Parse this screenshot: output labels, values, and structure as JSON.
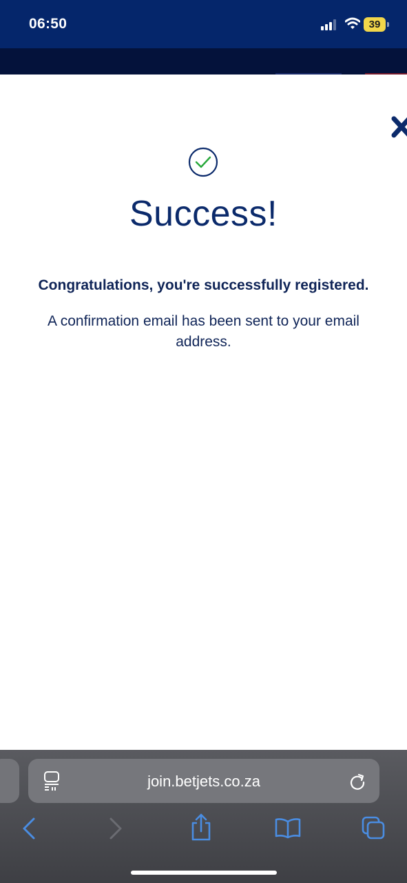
{
  "status_bar": {
    "time": "06:50",
    "battery": "39",
    "icons": [
      "signal-icon",
      "wifi-icon",
      "battery-icon"
    ],
    "background_color": "#05266b"
  },
  "site_header": {
    "background_color": "#04123b"
  },
  "dialog": {
    "close_icon": "close-icon",
    "success_icon": "check-circle-icon",
    "title": "Success!",
    "congrats_text": "Congratulations, you're successfully registered.",
    "confirmation_text": "A confirmation email has been sent to your email address.",
    "title_color": "#0b2a6b",
    "check_color": "#27a83a"
  },
  "browser": {
    "url": "join.betjets.co.za",
    "icons": {
      "reader": "reader-mode-icon",
      "reload": "reload-icon",
      "back": "back-icon",
      "forward": "forward-icon",
      "share": "share-icon",
      "bookmarks": "bookmarks-icon",
      "tabs": "tabs-icon"
    }
  }
}
